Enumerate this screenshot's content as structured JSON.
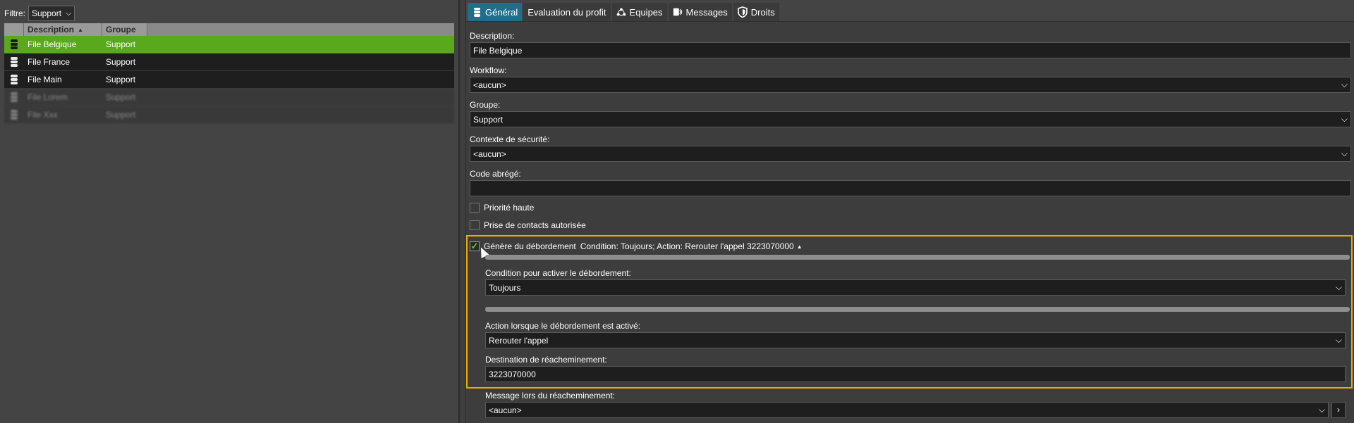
{
  "left": {
    "filter_label": "Filtre:",
    "filter_value": "Support",
    "columns": {
      "description": "Description",
      "group": "Groupe"
    },
    "rows": [
      {
        "description": "File Belgique",
        "group": "Support",
        "selected": true
      },
      {
        "description": "File France",
        "group": "Support",
        "selected": false
      },
      {
        "description": "File Main",
        "group": "Support",
        "selected": false
      },
      {
        "description": "File Lorem",
        "group": "Support",
        "blurred": true
      },
      {
        "description": "File Xxx",
        "group": "Support",
        "blurred": true
      }
    ]
  },
  "tabs": [
    {
      "label": "Général",
      "icon": "database-icon",
      "active": true
    },
    {
      "label": "Evaluation du profit",
      "icon": "",
      "active": false
    },
    {
      "label": "Equipes",
      "icon": "team-icon",
      "active": false
    },
    {
      "label": "Messages",
      "icon": "messages-icon",
      "active": false
    },
    {
      "label": "Droits",
      "icon": "shield-icon",
      "active": false
    }
  ],
  "form": {
    "description_label": "Description:",
    "description_value": "File Belgique",
    "workflow_label": "Workflow:",
    "workflow_value": "<aucun>",
    "group_label": "Groupe:",
    "group_value": "Support",
    "security_label": "Contexte de sécurité:",
    "security_value": "<aucun>",
    "code_label": "Code abrégé:",
    "code_value": "",
    "priority_label": "Priorité haute",
    "priority_checked": false,
    "contacts_label": "Prise de contacts autorisée",
    "contacts_checked": false,
    "overflow_label": "Génère du débordement",
    "overflow_summary": "Condition: Toujours; Action: Rerouter l'appel 3223070000",
    "overflow_checked": true,
    "condition_label": "Condition pour activer le débordement:",
    "condition_value": "Toujours",
    "action_label": "Action lorsque le débordement est activé:",
    "action_value": "Rerouter l'appel",
    "destination_label": "Destination de réacheminement:",
    "destination_value": "3223070000",
    "message_label": "Message lors du réacheminement:",
    "message_value": "<aucun>"
  },
  "colors": {
    "selected_row": "#5aa81b",
    "active_tab": "#1f6e8c",
    "highlight_border": "#f2a900"
  }
}
